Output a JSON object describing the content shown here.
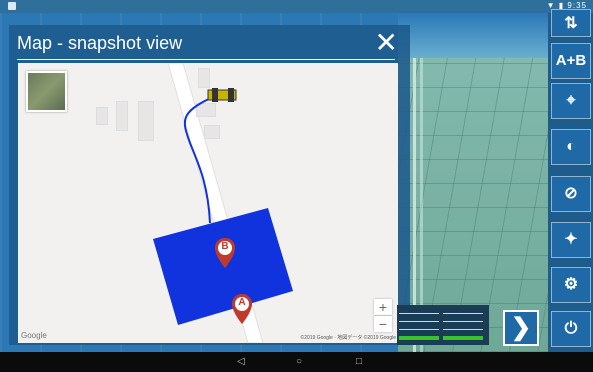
{
  "statusbar": {
    "time": "▼ ▮ 9:35"
  },
  "panel": {
    "title": "Map - snapshot view",
    "close": "✕"
  },
  "map": {
    "zoom_in": "+",
    "zoom_out": "−",
    "google": "Google",
    "credit": "©2019 Google · 地図データ ©2019 Google",
    "pin_a": "A",
    "pin_b": "B"
  },
  "toolbar": {
    "a_plus_b": "A+B"
  },
  "colors": {
    "field": "#1133dd",
    "pin": "#c0392b",
    "accent": "#1f6aa6"
  },
  "icons": [
    "sort-icon",
    "ab-line-icon",
    "map-location-icon",
    "brightness-icon",
    "compass-icon",
    "satellite-icon",
    "settings-icon",
    "power-icon",
    "chevron-right-icon"
  ]
}
